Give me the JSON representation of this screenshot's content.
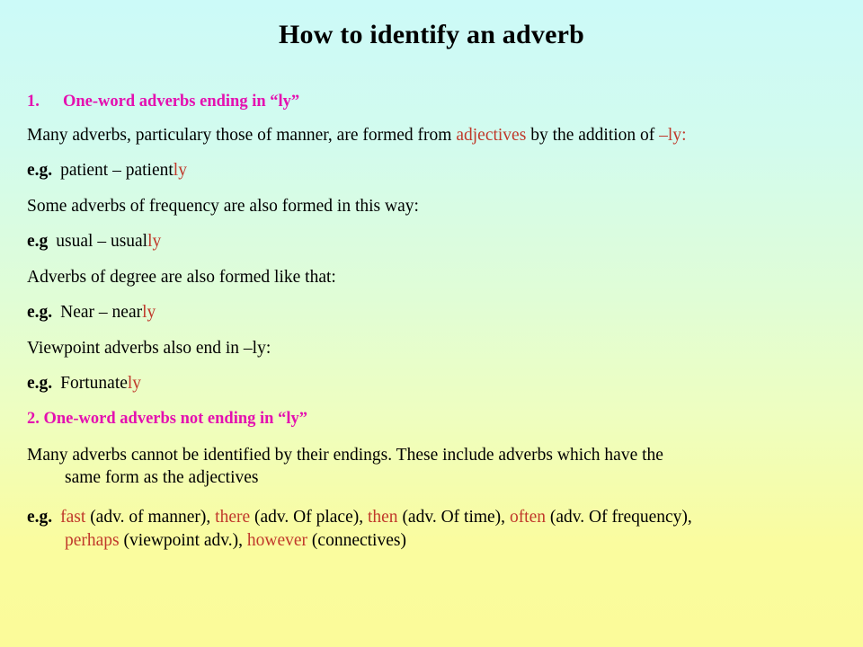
{
  "slide": {
    "title": "How to identify an adverb",
    "background": {
      "top_color": "#ccfaf8",
      "mid_color": "#e0fdd6",
      "bottom_color": "#fbfb99"
    },
    "accent_colors": {
      "heading_magenta": "#e410b0",
      "highlight_red": "#c0392b",
      "text_black": "#000000"
    }
  },
  "sections": [
    {
      "number": "1.",
      "heading": "One-word adverbs ending in “ly”",
      "lines": [
        {
          "type": "paragraph",
          "parts": [
            {
              "text": "Many adverbs, particulary those of manner, are formed from ",
              "color": "black"
            },
            {
              "text": "adjectives",
              "color": "red"
            },
            {
              "text": " by the addition of ",
              "color": "black"
            },
            {
              "text": "–ly:",
              "color": "red"
            }
          ]
        },
        {
          "type": "example",
          "label": "e.g.",
          "parts": [
            {
              "text": "patient – patient",
              "color": "black"
            },
            {
              "text": "ly",
              "color": "red"
            }
          ]
        },
        {
          "type": "paragraph",
          "parts": [
            {
              "text": "Some adverbs of frequency are also formed in this way:",
              "color": "black"
            }
          ]
        },
        {
          "type": "example",
          "label": "e.g",
          "parts": [
            {
              "text": "usual – usual",
              "color": "black"
            },
            {
              "text": "ly",
              "color": "red"
            }
          ]
        },
        {
          "type": "paragraph",
          "parts": [
            {
              "text": "Adverbs of degree are also formed like that:",
              "color": "black"
            }
          ]
        },
        {
          "type": "example",
          "label": "e.g.",
          "parts": [
            {
              "text": "Near – near",
              "color": "black"
            },
            {
              "text": "ly",
              "color": "red"
            }
          ]
        },
        {
          "type": "paragraph",
          "parts": [
            {
              "text": "Viewpoint adverbs also end in –ly:",
              "color": "black"
            }
          ]
        },
        {
          "type": "example",
          "label": "e.g.",
          "parts": [
            {
              "text": "Fortunate",
              "color": "black"
            },
            {
              "text": "ly",
              "color": "red"
            }
          ]
        }
      ]
    },
    {
      "number": "2.",
      "heading": "2. One-word adverbs not ending in “ly”",
      "lines": [
        {
          "type": "paragraph_justified",
          "text_line_1": "Many adverbs cannot be identified by their endings. These include adverbs which have the",
          "text_line_2": "same form as the adjectives"
        },
        {
          "type": "example_wrapped",
          "label": "e.g.",
          "parts_line_1": [
            {
              "text": "fast",
              "color": "red"
            },
            {
              "text": " (adv. of manner), ",
              "color": "black"
            },
            {
              "text": "there",
              "color": "red"
            },
            {
              "text": " (adv. Of place), ",
              "color": "black"
            },
            {
              "text": "then",
              "color": "red"
            },
            {
              "text": " (adv. Of time), ",
              "color": "black"
            },
            {
              "text": "often",
              "color": "red"
            },
            {
              "text": " (adv. Of frequency),",
              "color": "black"
            }
          ],
          "parts_line_2": [
            {
              "text": "perhaps",
              "color": "red"
            },
            {
              "text": " (viewpoint adv.), ",
              "color": "black"
            },
            {
              "text": "however",
              "color": "red"
            },
            {
              "text": " (connectives)",
              "color": "black"
            }
          ]
        }
      ]
    }
  ]
}
